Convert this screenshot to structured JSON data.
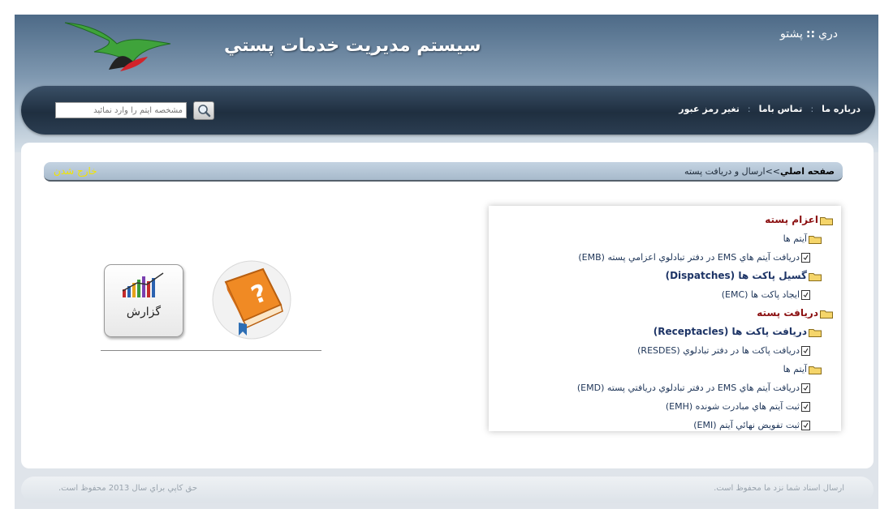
{
  "header": {
    "site_title": "سيستم مديريت خدمات پستي",
    "languages": [
      "دري",
      "پشتو"
    ],
    "lang_separator": "::"
  },
  "nav": {
    "links": [
      "درباره ما",
      "تماس باما",
      "تغير رمز عبور"
    ],
    "separator": ":",
    "search_placeholder": "مشخصه آيتم را وارد نمائيد",
    "search_icon": "magnifier-icon"
  },
  "breadcrumb": {
    "home": "صفحه اصلي",
    "arrow": ">>",
    "current": "ارسال و دريافت پسته",
    "logout": "خارج شدن"
  },
  "tree": [
    {
      "level": 0,
      "type": "folder",
      "style": "cat",
      "label": "اعزام پسته"
    },
    {
      "level": 1,
      "type": "folder",
      "style": "plain",
      "label": "آيتم ها"
    },
    {
      "level": 2,
      "type": "doc",
      "style": "plain",
      "label": "دريافت آيتم هاي EMS در دفتر تبادلوي اعزامي پسته (EMB)"
    },
    {
      "level": 1,
      "type": "folder",
      "style": "bold",
      "label": "گسيل پاکت ها (Dispatches)"
    },
    {
      "level": 2,
      "type": "doc",
      "style": "plain",
      "label": "ايجاد پاکت ها (EMC)"
    },
    {
      "level": 0,
      "type": "folder",
      "style": "cat",
      "label": "دريافت پسته"
    },
    {
      "level": 1,
      "type": "folder",
      "style": "bold",
      "label": "دريافت پاکت ها (Receptacles)"
    },
    {
      "level": 2,
      "type": "doc",
      "style": "plain",
      "label": "دريافت پاکت ها در دفتر تبادلوي (RESDES)"
    },
    {
      "level": 1,
      "type": "folder",
      "style": "plain",
      "label": "آيتم ها"
    },
    {
      "level": 2,
      "type": "doc",
      "style": "plain",
      "label": "دريافت آيتم هاي EMS در دفتر تبادلوي دريافتي پسته (EMD)"
    },
    {
      "level": 2,
      "type": "doc",
      "style": "plain",
      "label": "ثبت آيتم هاي مبادرت شونده (EMH)"
    },
    {
      "level": 2,
      "type": "doc",
      "style": "plain",
      "label": "ثبت تفويض نهائي آيتم (EMI)"
    }
  ],
  "tiles": {
    "help_icon": "help-book-icon",
    "report_label": "گزارش",
    "report_icon": "report-chart-icon"
  },
  "footer": {
    "left": "حق کاپي براي سال 2013 محفوظ است.",
    "right": "ارسال اسناد شما نزد ما محفوظ است."
  },
  "colors": {
    "header_top": "#4d6a87",
    "navbar": "#1f2f40",
    "category": "#8b0f10",
    "link": "#1d3466",
    "logout": "#f2e400"
  }
}
